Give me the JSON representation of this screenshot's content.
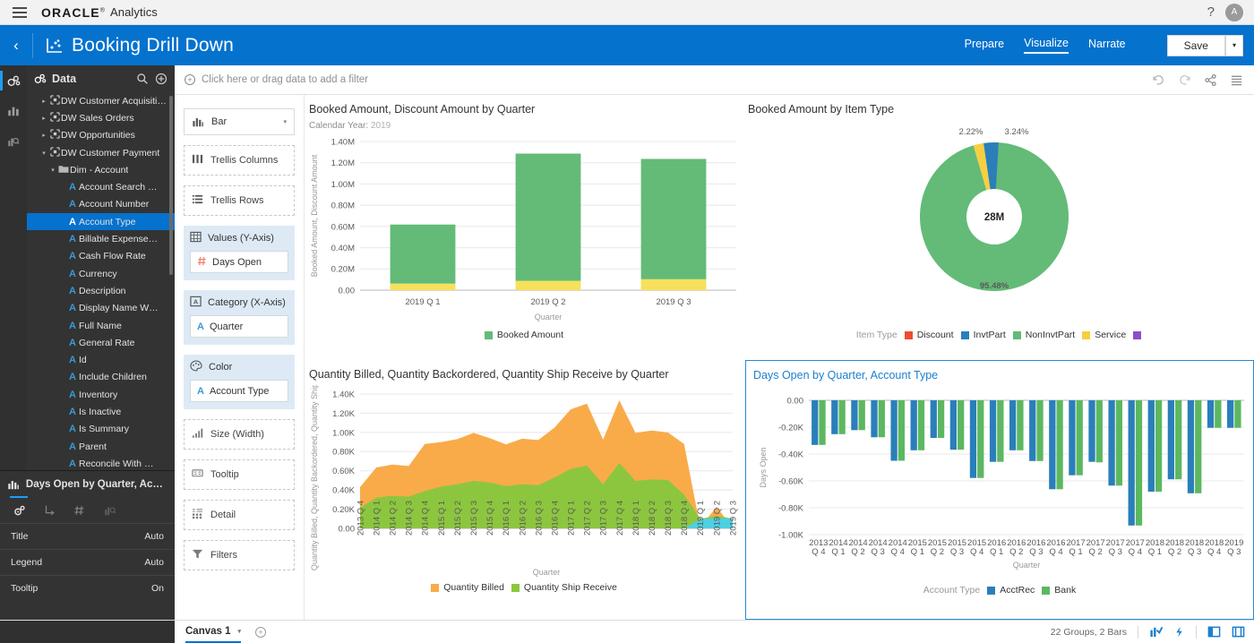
{
  "app": {
    "brand": "ORACLE",
    "brand_reg": "®",
    "brand_sub": "Analytics",
    "menu_icon": "hamburger-icon",
    "help_icon": "?",
    "avatar_initial": "A"
  },
  "header": {
    "back_icon": "‹",
    "project_icon": "scatter-chart-icon",
    "title": "Booking Drill Down",
    "tabs": [
      {
        "label": "Prepare",
        "active": false
      },
      {
        "label": "Visualize",
        "active": true
      },
      {
        "label": "Narrate",
        "active": false
      }
    ],
    "save_label": "Save",
    "save_caret": "▾"
  },
  "rail": {
    "items": [
      {
        "name": "data-icon",
        "active": true
      },
      {
        "name": "visualizations-icon",
        "active": false
      },
      {
        "name": "analytics-icon",
        "active": false
      }
    ]
  },
  "data_panel": {
    "title": "Data",
    "search_icon": "search-icon",
    "add_icon": "add-icon",
    "tree": [
      {
        "label": "DW Customer Acquisiti…",
        "icon": "dataset",
        "arrow": "▸",
        "indent": 1,
        "selected": false
      },
      {
        "label": "DW Sales Orders",
        "icon": "dataset",
        "arrow": "▸",
        "indent": 1,
        "selected": false
      },
      {
        "label": "DW Opportunities",
        "icon": "dataset",
        "arrow": "▸",
        "indent": 1,
        "selected": false
      },
      {
        "label": "DW Customer Payment",
        "icon": "dataset",
        "arrow": "▾",
        "indent": 1,
        "selected": false
      },
      {
        "label": "Dim - Account",
        "icon": "folder",
        "arrow": "▾",
        "indent": 2,
        "selected": false
      },
      {
        "label": "Account Search …",
        "icon": "attr",
        "arrow": "",
        "indent": 3,
        "selected": false
      },
      {
        "label": "Account Number",
        "icon": "attr",
        "arrow": "",
        "indent": 3,
        "selected": false
      },
      {
        "label": "Account Type",
        "icon": "attr",
        "arrow": "",
        "indent": 3,
        "selected": true
      },
      {
        "label": "Billable Expense…",
        "icon": "attr",
        "arrow": "",
        "indent": 3,
        "selected": false
      },
      {
        "label": "Cash Flow Rate",
        "icon": "attr",
        "arrow": "",
        "indent": 3,
        "selected": false
      },
      {
        "label": "Currency",
        "icon": "attr",
        "arrow": "",
        "indent": 3,
        "selected": false
      },
      {
        "label": "Description",
        "icon": "attr",
        "arrow": "",
        "indent": 3,
        "selected": false
      },
      {
        "label": "Display Name W…",
        "icon": "attr",
        "arrow": "",
        "indent": 3,
        "selected": false
      },
      {
        "label": "Full Name",
        "icon": "attr",
        "arrow": "",
        "indent": 3,
        "selected": false
      },
      {
        "label": "General Rate",
        "icon": "attr",
        "arrow": "",
        "indent": 3,
        "selected": false
      },
      {
        "label": "Id",
        "icon": "attr",
        "arrow": "",
        "indent": 3,
        "selected": false
      },
      {
        "label": "Include Children",
        "icon": "attr",
        "arrow": "",
        "indent": 3,
        "selected": false
      },
      {
        "label": "Inventory",
        "icon": "attr",
        "arrow": "",
        "indent": 3,
        "selected": false
      },
      {
        "label": "Is Inactive",
        "icon": "attr",
        "arrow": "",
        "indent": 3,
        "selected": false
      },
      {
        "label": "Is Summary",
        "icon": "attr",
        "arrow": "",
        "indent": 3,
        "selected": false
      },
      {
        "label": "Parent",
        "icon": "attr",
        "arrow": "",
        "indent": 3,
        "selected": false
      },
      {
        "label": "Reconcile With …",
        "icon": "attr",
        "arrow": "",
        "indent": 3,
        "selected": false
      }
    ]
  },
  "properties": {
    "icon": "bar-chart-icon",
    "title": "Days Open by Quarter, Acc…",
    "tabs": [
      {
        "name": "general-tab",
        "active": true
      },
      {
        "name": "axis-tab",
        "active": false
      },
      {
        "name": "number-format-tab",
        "active": false
      },
      {
        "name": "analytics-tab",
        "active": false
      }
    ],
    "rows": [
      {
        "label": "Title",
        "value": "Auto"
      },
      {
        "label": "Legend",
        "value": "Auto"
      },
      {
        "label": "Tooltip",
        "value": "On"
      }
    ]
  },
  "filter_bar": {
    "placeholder": "Click here or drag data to add a filter",
    "icons": [
      "undo-icon",
      "redo-icon",
      "share-icon",
      "menu-icon"
    ]
  },
  "shelf": {
    "viz_type": {
      "label": "Bar",
      "icon": "bar-chart-icon"
    },
    "sections": [
      {
        "name": "trellis-columns",
        "label": "Trellis Columns",
        "icon": "trellis-columns-icon",
        "filled": false,
        "pills": []
      },
      {
        "name": "trellis-rows",
        "label": "Trellis Rows",
        "icon": "trellis-rows-icon",
        "filled": false,
        "pills": []
      },
      {
        "name": "values-y-axis",
        "label": "Values (Y-Axis)",
        "icon": "values-icon",
        "filled": true,
        "pills": [
          {
            "label": "Days Open",
            "icon": "measure"
          }
        ]
      },
      {
        "name": "category-x-axis",
        "label": "Category (X-Axis)",
        "icon": "category-icon",
        "filled": true,
        "pills": [
          {
            "label": "Quarter",
            "icon": "attr"
          }
        ]
      },
      {
        "name": "color",
        "label": "Color",
        "icon": "color-palette-icon",
        "filled": true,
        "pills": [
          {
            "label": "Account Type",
            "icon": "attr"
          }
        ]
      },
      {
        "name": "size-width",
        "label": "Size (Width)",
        "icon": "size-icon",
        "filled": false,
        "pills": []
      },
      {
        "name": "tooltip",
        "label": "Tooltip",
        "icon": "tooltip-icon",
        "filled": false,
        "pills": []
      },
      {
        "name": "detail",
        "label": "Detail",
        "icon": "detail-icon",
        "filled": false,
        "pills": []
      },
      {
        "name": "filters",
        "label": "Filters",
        "icon": "funnel-icon",
        "filled": false,
        "pills": []
      }
    ]
  },
  "bottom_bar": {
    "canvas_label": "Canvas 1",
    "canvas_caret": "▾",
    "add_canvas_icon": "add-icon",
    "stats": "22 Groups, 2 Bars",
    "icons": [
      "insights-icon",
      "flash-icon",
      "right-panel-icon",
      "split-panel-icon"
    ]
  },
  "colors": {
    "brand_blue": "#0572ce",
    "green": "#63bb77",
    "yellow": "#f7e05b",
    "orange": "#f9ab4a",
    "olive": "#8cc63f",
    "cyan": "#4dd0e1",
    "series_blue": "#2a7fba",
    "series_green": "#5cb860",
    "red": "#ef4b33",
    "purple": "#8b4fc9"
  },
  "chart_data": [
    {
      "id": "booked-discount-by-quarter",
      "type": "bar",
      "title": "Booked Amount, Discount Amount by Quarter",
      "subtitle_label": "Calendar Year:",
      "subtitle_value": "2019",
      "xlabel": "Quarter",
      "ylabel": "Booked Amount, Discount Amount",
      "categories": [
        "2019 Q 1",
        "2019 Q 2",
        "2019 Q 3"
      ],
      "ylim": [
        0,
        1400000
      ],
      "yticks": [
        "0.00",
        "0.20M",
        "0.40M",
        "0.60M",
        "0.80M",
        "1.00M",
        "1.20M",
        "1.40M"
      ],
      "ytick_values": [
        0,
        200000,
        400000,
        600000,
        800000,
        1000000,
        1200000,
        1400000
      ],
      "stacked": true,
      "series": [
        {
          "name": "Discount Amount",
          "color": "#f7e05b",
          "values": [
            62000,
            88000,
            103000
          ]
        },
        {
          "name": "Booked Amount",
          "color": "#63bb77",
          "values": [
            556000,
            1198000,
            1133000
          ]
        }
      ],
      "legend": [
        {
          "label": "Booked Amount",
          "color": "#63bb77"
        }
      ],
      "legend_position": "bottom",
      "grid": true
    },
    {
      "id": "booked-amount-by-item-type",
      "type": "pie",
      "title": "Booked Amount by Item Type",
      "center_label": "28M",
      "donut": true,
      "slices": [
        {
          "label": "NonInvtPart",
          "value": 95.48,
          "display": "95.48%",
          "color": "#63bb77"
        },
        {
          "label": "Service",
          "value": 2.22,
          "display": "2.22%",
          "color": "#f7cf3f"
        },
        {
          "label": "InvtPart",
          "value": 3.24,
          "display": "3.24%",
          "color": "#2a7fba"
        }
      ],
      "legend_caption": "Item Type",
      "legend": [
        {
          "label": "Discount",
          "color": "#ef4b33"
        },
        {
          "label": "InvtPart",
          "color": "#2a7fba"
        },
        {
          "label": "NonInvtPart",
          "color": "#63bb77"
        },
        {
          "label": "Service",
          "color": "#f7cf3f"
        },
        {
          "label": "",
          "color": "#8b4fc9"
        }
      ],
      "legend_position": "bottom"
    },
    {
      "id": "quantity-by-quarter",
      "type": "area",
      "title": "Quantity Billed, Quantity Backordered, Quantity Ship Receive by Quarter",
      "xlabel": "Quarter",
      "ylabel": "Quantity Billed, Quantity Backordered, Quantity Ship Receive",
      "ylim": [
        0,
        1400
      ],
      "yticks": [
        "0.00",
        "0.20K",
        "0.40K",
        "0.60K",
        "0.80K",
        "1.00K",
        "1.20K",
        "1.40K"
      ],
      "ytick_values": [
        0,
        200,
        400,
        600,
        800,
        1000,
        1200,
        1400
      ],
      "x": [
        "2013 Q 4",
        "2014 Q 1",
        "2014 Q 2",
        "2014 Q 3",
        "2014 Q 4",
        "2015 Q 1",
        "2015 Q 2",
        "2015 Q 3",
        "2015 Q 4",
        "2016 Q 1",
        "2016 Q 2",
        "2016 Q 3",
        "2016 Q 4",
        "2017 Q 1",
        "2017 Q 2",
        "2017 Q 3",
        "2017 Q 4",
        "2018 Q 1",
        "2018 Q 2",
        "2018 Q 3",
        "2018 Q 4",
        "2019 Q 1",
        "2019 Q 2",
        "2019 Q 3"
      ],
      "stacked": true,
      "series": [
        {
          "name": "Quantity Billed",
          "color": "#f9ab4a",
          "values": [
            430,
            635,
            665,
            650,
            880,
            900,
            930,
            995,
            940,
            875,
            935,
            920,
            1050,
            1240,
            1300,
            925,
            1335,
            995,
            1020,
            1000,
            880,
            10,
            225,
            5
          ]
        },
        {
          "name": "Quantity Ship Receive",
          "color": "#8cc63f",
          "values": [
            215,
            320,
            340,
            330,
            390,
            435,
            460,
            495,
            480,
            440,
            460,
            450,
            530,
            620,
            655,
            460,
            680,
            495,
            510,
            505,
            350,
            5,
            20,
            2
          ]
        },
        {
          "name": "Quantity Backordered",
          "color": "#4dd0e1",
          "values": [
            0,
            0,
            0,
            0,
            0,
            0,
            0,
            0,
            0,
            0,
            0,
            0,
            0,
            0,
            0,
            0,
            0,
            0,
            0,
            0,
            0,
            95,
            110,
            100
          ]
        }
      ],
      "legend": [
        {
          "label": "Quantity Billed",
          "color": "#f9ab4a"
        },
        {
          "label": "Quantity Ship Receive",
          "color": "#8cc63f"
        }
      ],
      "legend_position": "bottom",
      "grid": true
    },
    {
      "id": "days-open-by-quarter-account-type",
      "type": "bar",
      "title": "Days Open by Quarter, Account Type",
      "xlabel": "Quarter",
      "ylabel": "Days Open",
      "ylim": [
        -1000,
        0
      ],
      "yticks": [
        "0.00",
        "-0.20K",
        "-0.40K",
        "-0.60K",
        "-0.80K",
        "-1.00K"
      ],
      "ytick_values": [
        0,
        -200,
        -400,
        -600,
        -800,
        -1000
      ],
      "categories": [
        "2013 Q 4",
        "2014 Q 1",
        "2014 Q 2",
        "2014 Q 3",
        "2014 Q 4",
        "2015 Q 1",
        "2015 Q 2",
        "2015 Q 3",
        "2015 Q 4",
        "2016 Q 1",
        "2016 Q 2",
        "2016 Q 3",
        "2016 Q 4",
        "2017 Q 1",
        "2017 Q 2",
        "2017 Q 3",
        "2017 Q 4",
        "2018 Q 1",
        "2018 Q 2",
        "2018 Q 3",
        "2018 Q 4",
        "2019 Q 3"
      ],
      "series": [
        {
          "name": "AcctRec",
          "color": "#2a7fba",
          "values": [
            -332,
            -252,
            -222,
            -275,
            -450,
            -372,
            -280,
            -368,
            -578,
            -458,
            -372,
            -452,
            -662,
            -558,
            -458,
            -635,
            -932,
            -680,
            -588,
            -692,
            -205,
            -205
          ]
        },
        {
          "name": "Bank",
          "color": "#5cb860",
          "values": [
            -332,
            -252,
            -222,
            -275,
            -450,
            -372,
            -280,
            -368,
            -578,
            -458,
            -372,
            -452,
            -662,
            -558,
            -462,
            -635,
            -932,
            -680,
            -588,
            -692,
            -205,
            -205
          ]
        }
      ],
      "legend_caption": "Account Type",
      "legend": [
        {
          "label": "AcctRec",
          "color": "#2a7fba"
        },
        {
          "label": "Bank",
          "color": "#5cb860"
        }
      ],
      "legend_position": "bottom",
      "grid": true,
      "selected": true
    }
  ]
}
